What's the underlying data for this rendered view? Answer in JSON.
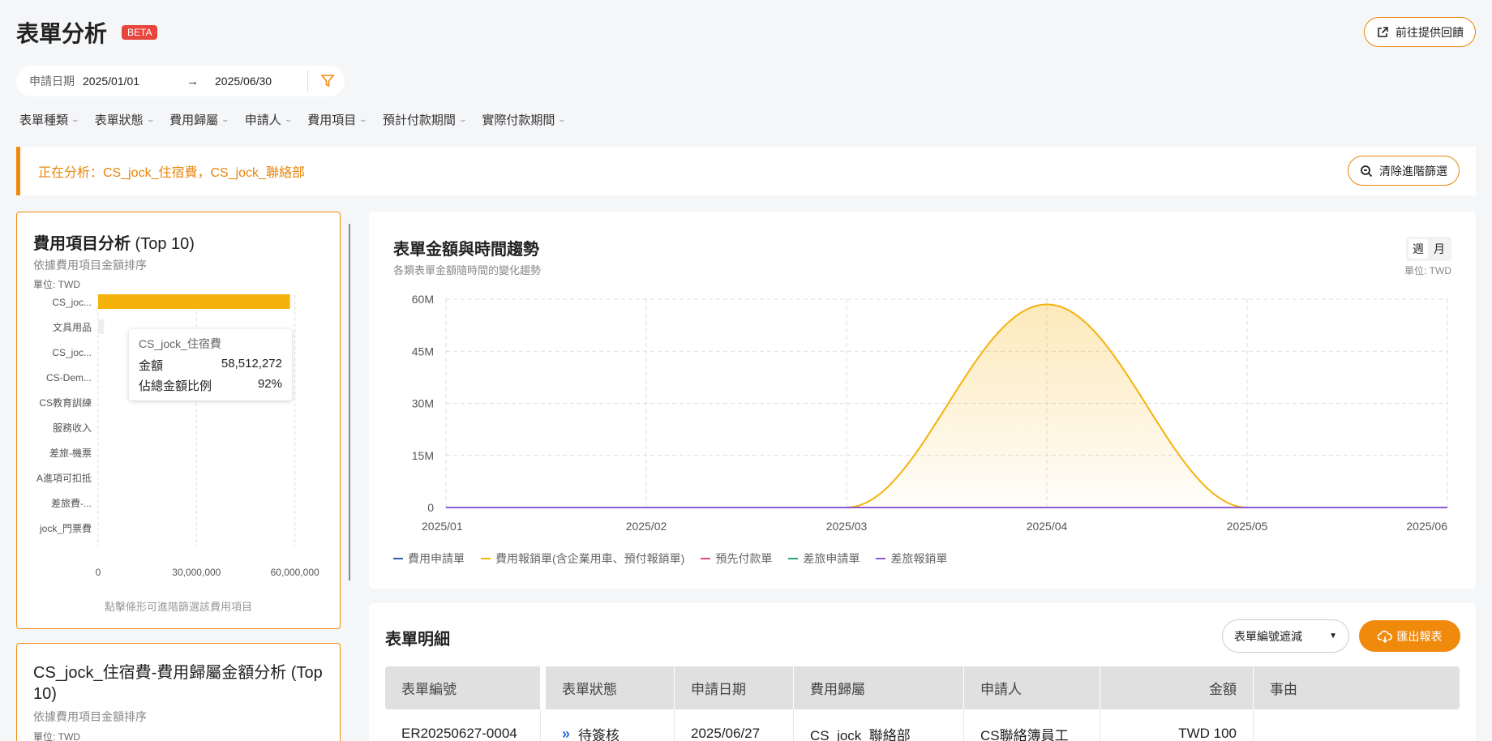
{
  "header": {
    "title": "表單分析",
    "badge": "BETA",
    "feedback_label": "前往提供回饋"
  },
  "date_filter": {
    "label": "申請日期",
    "start": "2025/01/01",
    "end": "2025/06/30"
  },
  "filters": [
    "表單種類",
    "表單狀態",
    "費用歸屬",
    "申請人",
    "費用項目",
    "預計付款期間",
    "實際付款期間"
  ],
  "banner": {
    "text": "正在分析：CS_jock_住宿費，CS_jock_聯絡部",
    "clear_label": "清除進階篩選"
  },
  "expense_card": {
    "title_bold": "費用項目分析",
    "title_rest": " (Top 10)",
    "subtitle": "依據費用項目金額排序",
    "unit": "單位: TWD",
    "hint": "點擊條形可進階篩選該費用項目",
    "tooltip": {
      "title": "CS_jock_住宿費",
      "amount_label": "金額",
      "amount_value": "58,512,272",
      "ratio_label": "佔總金額比例",
      "ratio_value": "92%"
    }
  },
  "chart_data": [
    {
      "type": "bar",
      "orientation": "horizontal",
      "categories": [
        "CS_joc...",
        "文具用品",
        "CS_joc...",
        "CS-Dem...",
        "CS教育訓練",
        "服務收入",
        "差旅-機票",
        "A進項可扣抵",
        "差旅費-...",
        "jock_門票費"
      ],
      "values": [
        58512272,
        1800000,
        0,
        0,
        0,
        0,
        0,
        0,
        0,
        0
      ],
      "xlim": [
        0,
        68000000
      ],
      "x_ticks": [
        "0",
        "30,000,000",
        "60,000,000"
      ],
      "highlight_color": "#f5b20a",
      "muted_color": "#eeeeee"
    },
    {
      "type": "area",
      "title": "表單金額與時間趨勢",
      "subtitle": "各類表單金額隨時間的變化趨勢",
      "unit": "單位: TWD",
      "x": [
        "2025/01",
        "2025/02",
        "2025/03",
        "2025/04",
        "2025/05",
        "2025/06"
      ],
      "y_ticks": [
        "0",
        "15M",
        "30M",
        "45M",
        "60M"
      ],
      "ylim": [
        0,
        60000000
      ],
      "series": [
        {
          "name": "費用申請單",
          "color": "#2d5fa8",
          "values": [
            0,
            0,
            0,
            0,
            0,
            0
          ]
        },
        {
          "name": "費用報銷單(含企業用車、預付報銷單)",
          "color": "#f5b20a",
          "values": [
            0,
            0,
            0,
            58512272,
            0,
            0
          ]
        },
        {
          "name": "預先付款單",
          "color": "#e8466c",
          "values": [
            0,
            0,
            0,
            0,
            0,
            0
          ]
        },
        {
          "name": "差旅申請單",
          "color": "#2aa37a",
          "values": [
            0,
            0,
            0,
            0,
            0,
            0
          ]
        },
        {
          "name": "差旅報銷單",
          "color": "#8a5cd6",
          "values": [
            0,
            0,
            0,
            0,
            0,
            0
          ]
        }
      ]
    }
  ],
  "trend_toggle": {
    "week": "週",
    "month": "月"
  },
  "fee_owner_card": {
    "title": "CS_jock_住宿費-費用歸屬金額分析 (Top 10)",
    "subtitle": "依據費用項目金額排序",
    "unit": "單位: TWD"
  },
  "table": {
    "title": "表單明細",
    "mask_label": "表單編號遮減",
    "export_label": "匯出報表",
    "columns": [
      "表單編號",
      "表單狀態",
      "申請日期",
      "費用歸屬",
      "申請人",
      "金額",
      "事由"
    ],
    "rows": [
      {
        "id": "ER20250627-0004",
        "status": "待簽核",
        "date": "2025/06/27",
        "owner": "CS_jock_聯絡部",
        "applicant": "CS聯絡簿員工",
        "amount": "TWD 100",
        "reason": ""
      }
    ]
  }
}
